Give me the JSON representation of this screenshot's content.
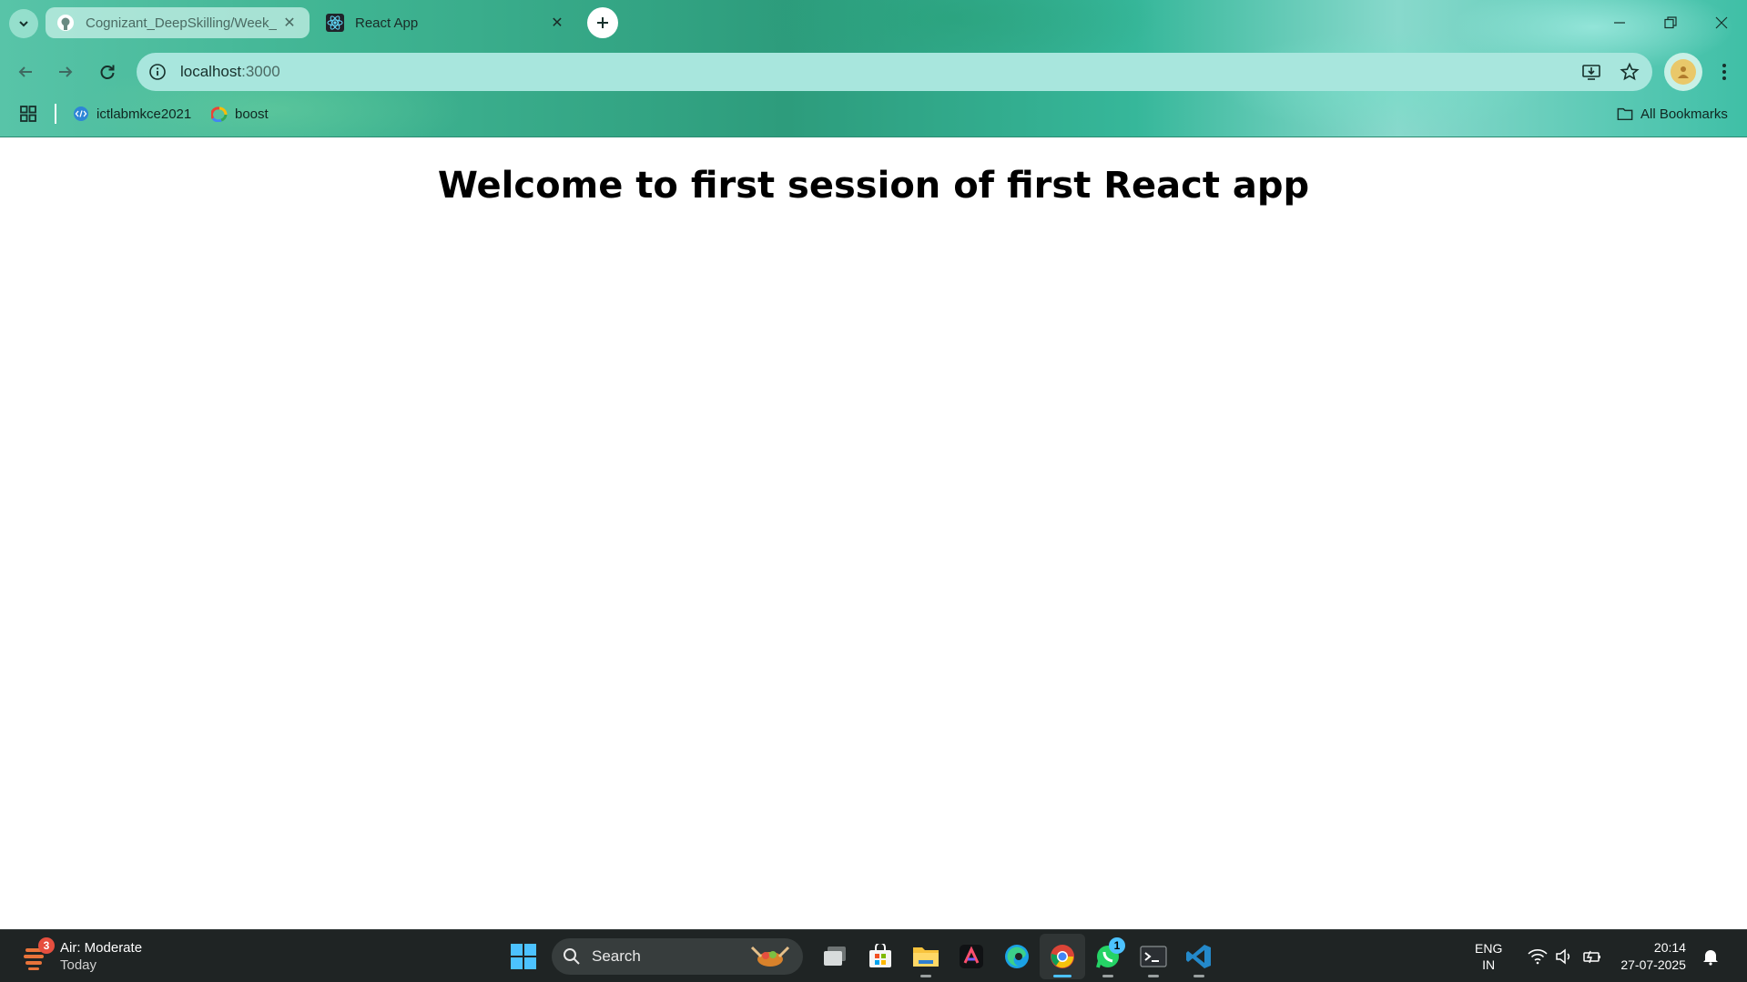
{
  "browser": {
    "tabs": [
      {
        "title": "Cognizant_DeepSkilling/Week_",
        "favicon": "github-icon",
        "active": false
      },
      {
        "title": "React App",
        "favicon": "react-icon",
        "active": true
      }
    ],
    "address": {
      "host": "localhost",
      "port": ":3000"
    },
    "bookmarks": [
      {
        "label": "ictlabmkce2021",
        "icon": "code-icon"
      },
      {
        "label": "boost",
        "icon": "google-icon"
      }
    ],
    "all_bookmarks_label": "All Bookmarks"
  },
  "page": {
    "heading": "Welcome to first session of first React app"
  },
  "taskbar": {
    "weather": {
      "title": "Air: Moderate",
      "subtitle": "Today",
      "badge": "3"
    },
    "search_label": "Search",
    "whatsapp_badge": "1",
    "language": {
      "line1": "ENG",
      "line2": "IN"
    },
    "clock": {
      "time": "20:14",
      "date": "27-07-2025"
    }
  }
}
